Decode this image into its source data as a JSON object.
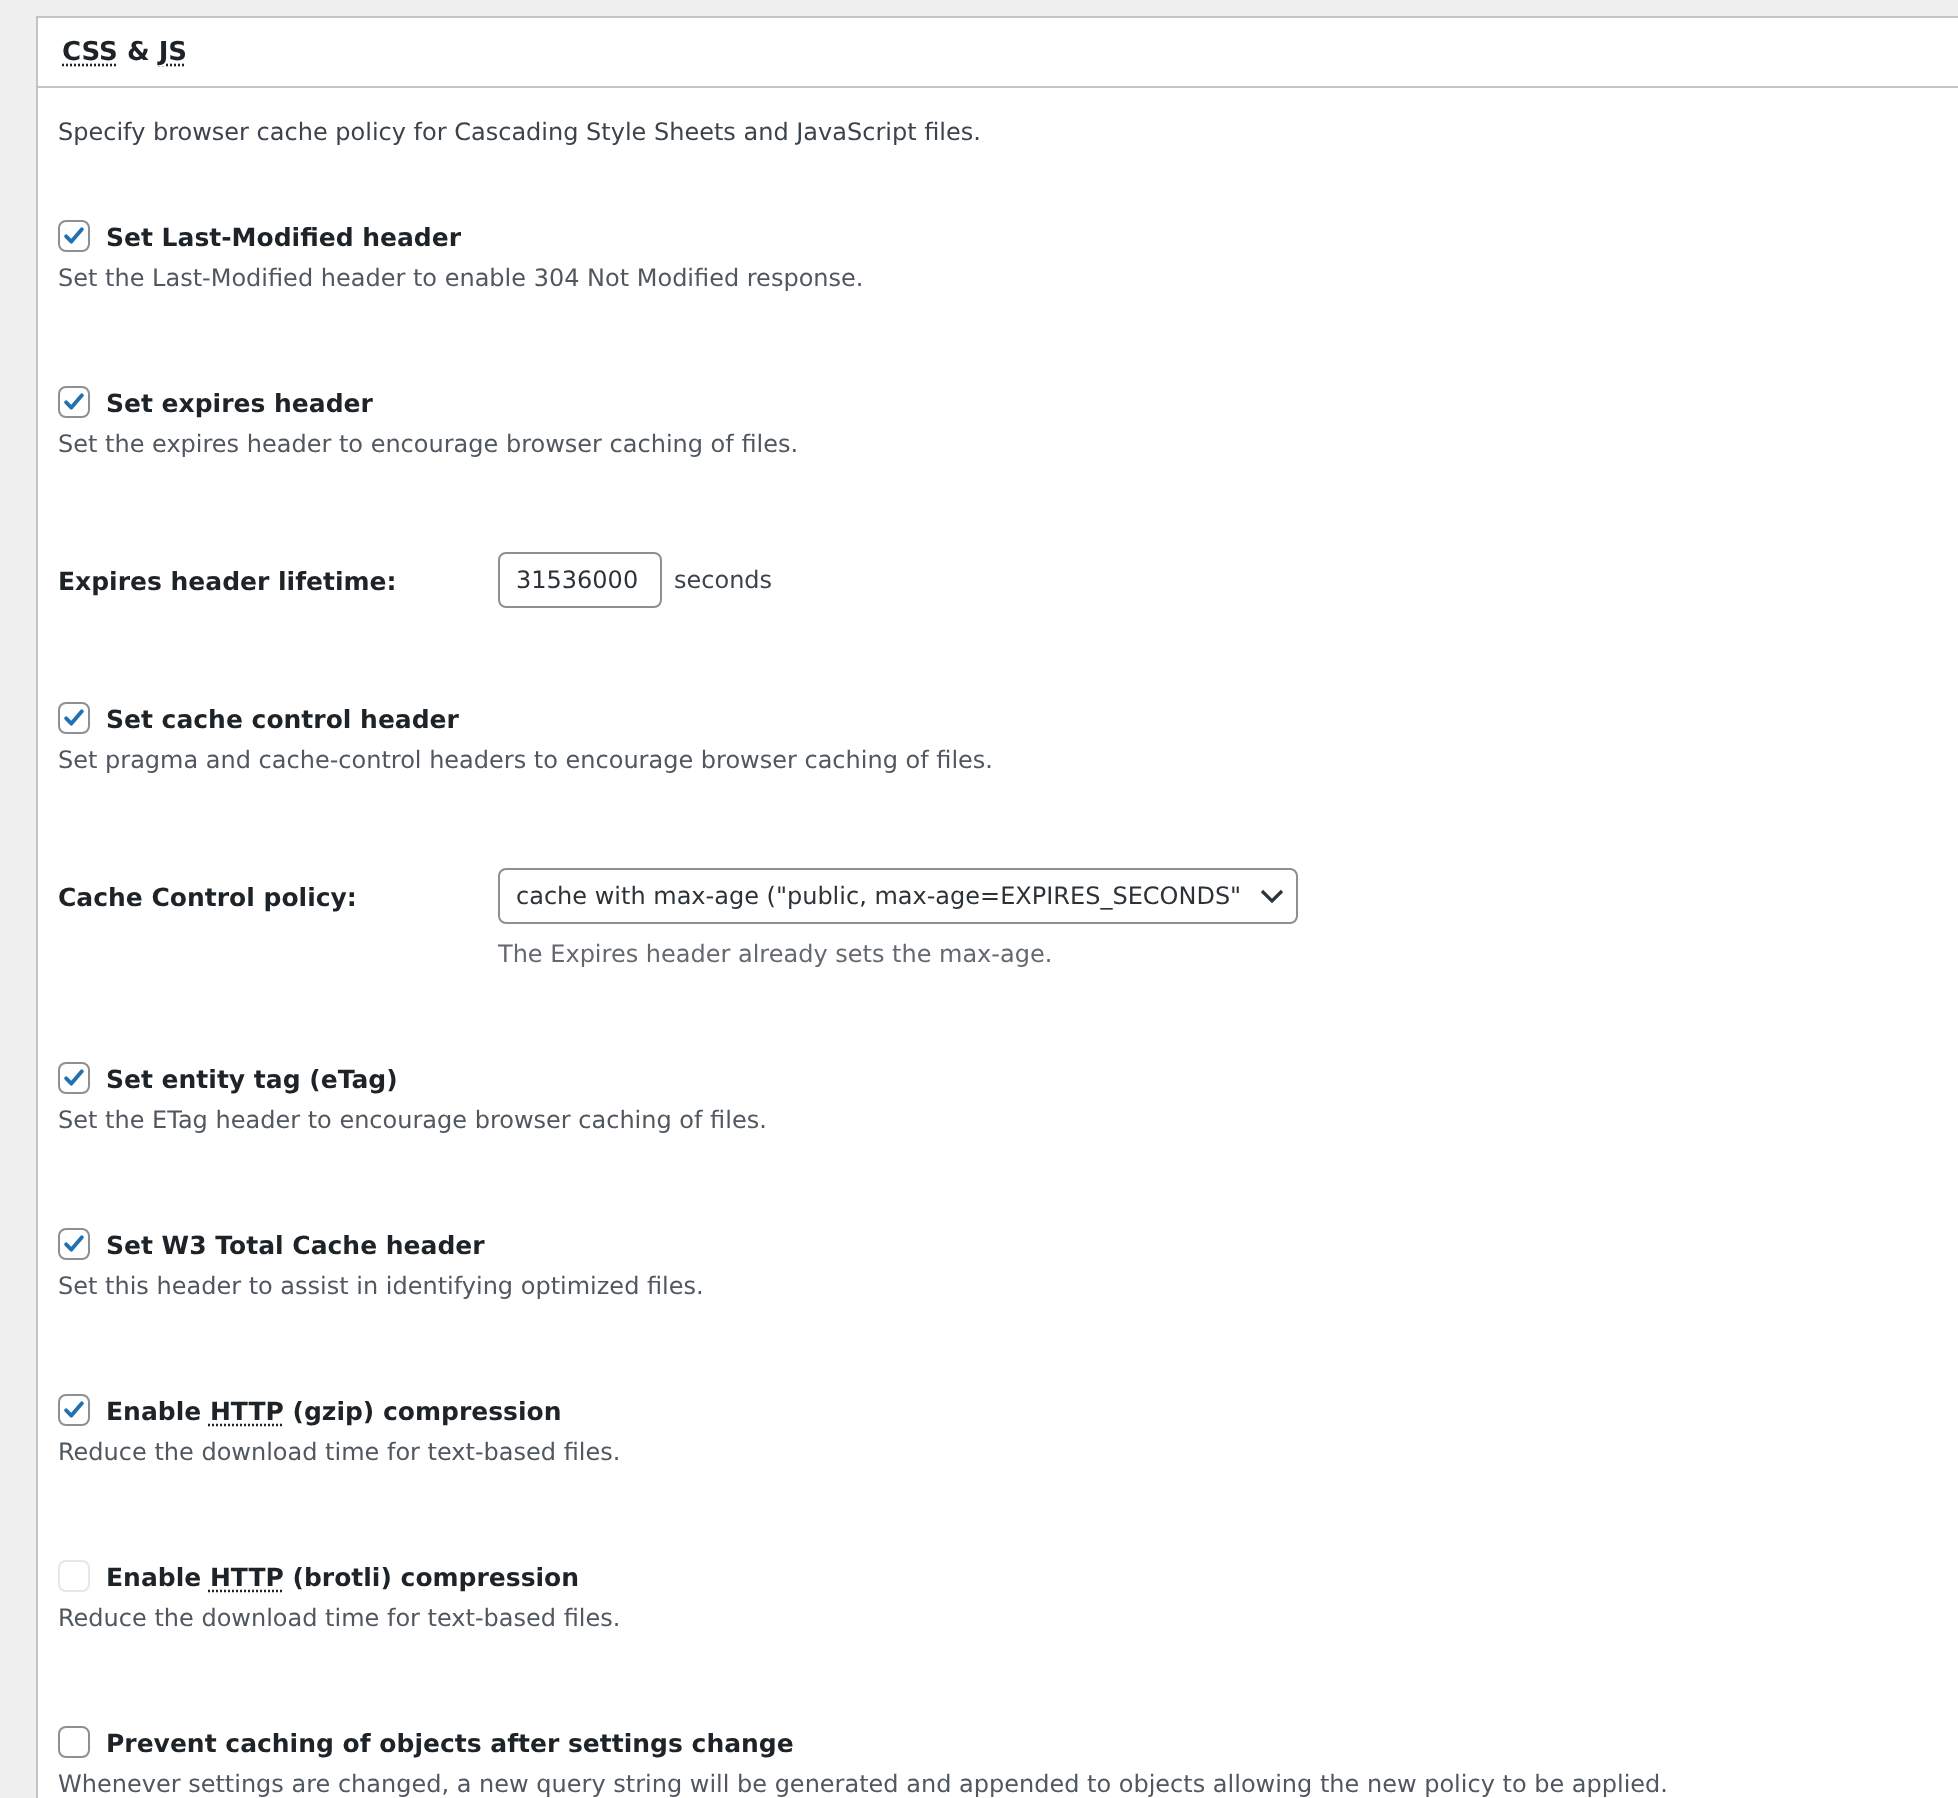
{
  "panel": {
    "title": [
      {
        "text": "CSS",
        "abbr": true
      },
      {
        "text": " & ",
        "abbr": false
      },
      {
        "text": "JS",
        "abbr": true
      }
    ],
    "intro": "Specify browser cache policy for Cascading Style Sheets and JavaScript files.",
    "options": [
      {
        "kind": "checkbox",
        "label": [
          {
            "text": "Set Last-Modified header",
            "abbr": false
          }
        ],
        "checked": true,
        "disabled": false,
        "description": "Set the Last-Modified header to enable 304 Not Modified response."
      },
      {
        "kind": "checkbox",
        "label": [
          {
            "text": "Set expires header",
            "abbr": false
          }
        ],
        "checked": true,
        "disabled": false,
        "description": "Set the expires header to encourage browser caching of files."
      },
      {
        "kind": "text_field",
        "label": "Expires header lifetime:",
        "value": "31536000",
        "unit": "seconds"
      },
      {
        "kind": "checkbox",
        "label": [
          {
            "text": "Set cache control header",
            "abbr": false
          }
        ],
        "checked": true,
        "disabled": false,
        "description": "Set pragma and cache-control headers to encourage browser caching of files."
      },
      {
        "kind": "select",
        "label": "Cache Control policy:",
        "value": "cache with max-age (\"public, max-age=EXPIRES_SECONDS\"",
        "note": "The Expires header already sets the max-age."
      },
      {
        "kind": "checkbox",
        "label": [
          {
            "text": "Set entity tag (eTag)",
            "abbr": false
          }
        ],
        "checked": true,
        "disabled": false,
        "description": "Set the ETag header to encourage browser caching of files."
      },
      {
        "kind": "checkbox",
        "label": [
          {
            "text": "Set W3 Total Cache header",
            "abbr": false
          }
        ],
        "checked": true,
        "disabled": false,
        "description": "Set this header to assist in identifying optimized files."
      },
      {
        "kind": "checkbox",
        "label": [
          {
            "text": "Enable ",
            "abbr": false
          },
          {
            "text": "HTTP",
            "abbr": true
          },
          {
            "text": " (gzip) compression",
            "abbr": false
          }
        ],
        "checked": true,
        "disabled": false,
        "description": "Reduce the download time for text-based files."
      },
      {
        "kind": "checkbox",
        "label": [
          {
            "text": "Enable ",
            "abbr": false
          },
          {
            "text": "HTTP",
            "abbr": true
          },
          {
            "text": " (brotli) compression",
            "abbr": false
          }
        ],
        "checked": false,
        "disabled": true,
        "description": "Reduce the download time for text-based files."
      },
      {
        "kind": "checkbox",
        "label": [
          {
            "text": "Prevent caching of objects after settings change",
            "abbr": false
          }
        ],
        "checked": false,
        "disabled": false,
        "description": "Whenever settings are changed, a new query string will be generated and appended to objects allowing the new policy to be applied."
      }
    ]
  }
}
